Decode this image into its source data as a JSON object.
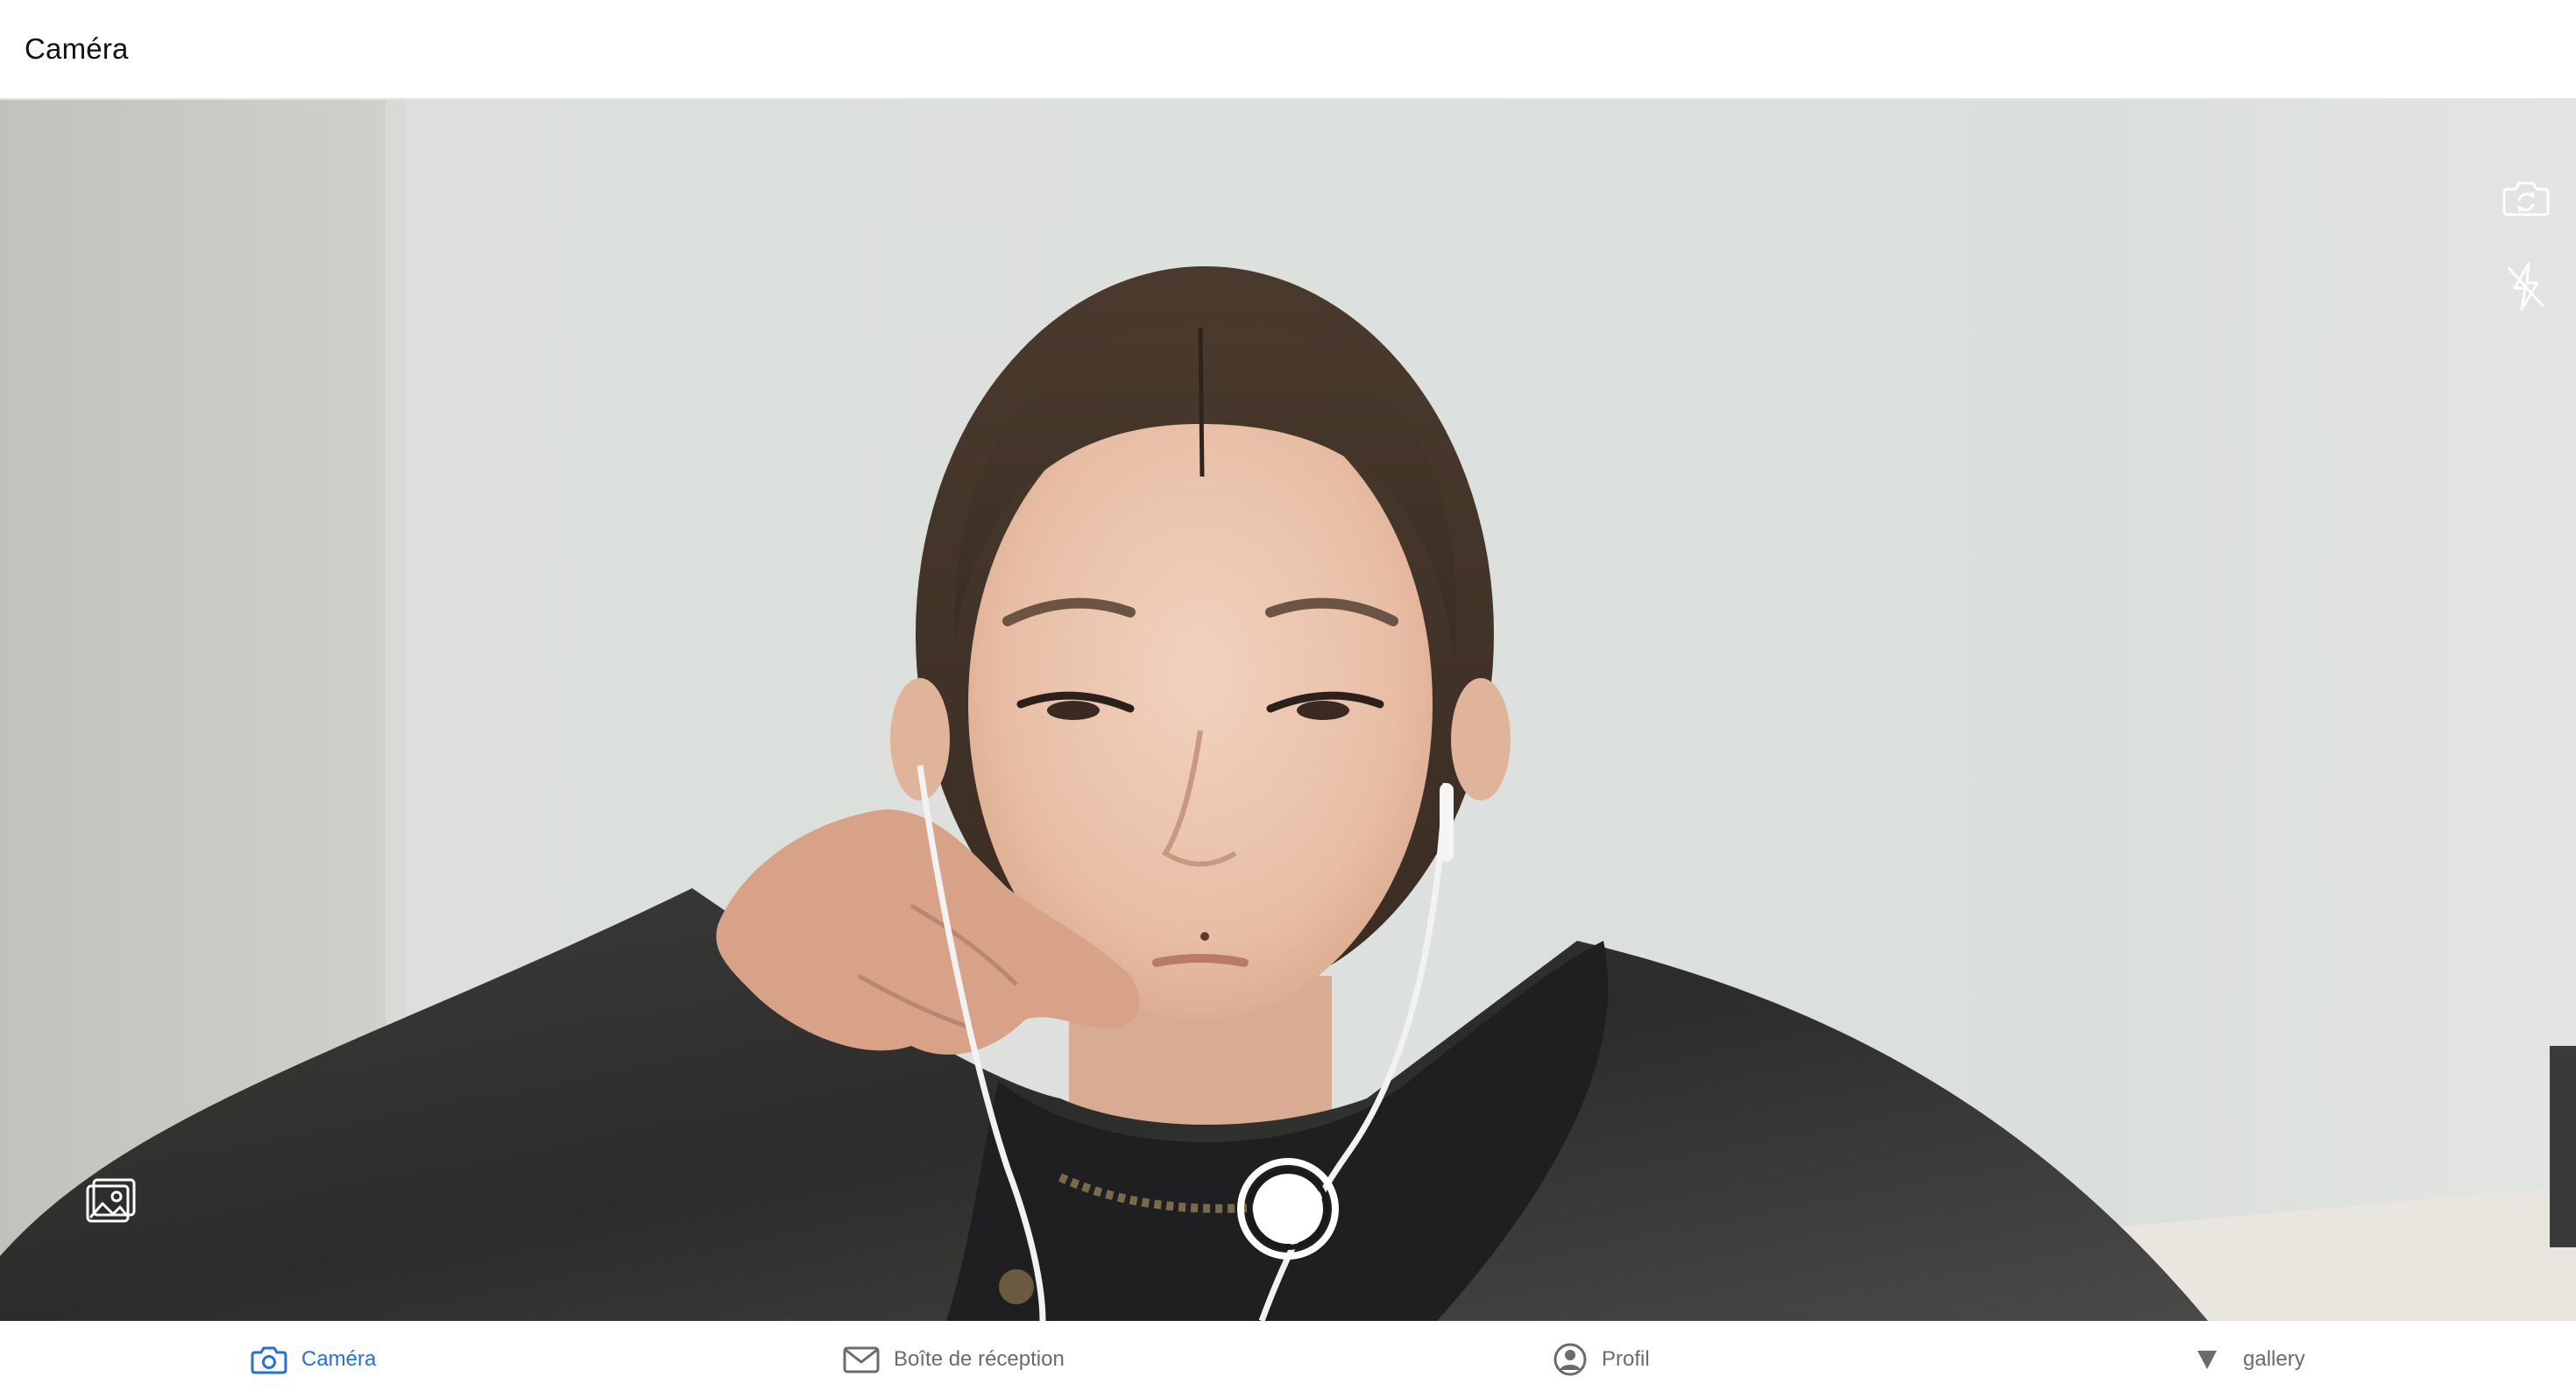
{
  "header": {
    "title": "Caméra"
  },
  "camera": {
    "switch_icon": "camera-switch-icon",
    "flash_icon": "flash-off-icon",
    "gallery_icon": "photo-gallery-icon",
    "shutter_icon": "shutter-button"
  },
  "tabs": [
    {
      "label": "Caméra",
      "icon": "camera-icon",
      "active": true
    },
    {
      "label": "Boîte de réception",
      "icon": "mail-icon",
      "active": false
    },
    {
      "label": "Profil",
      "icon": "user-circle-icon",
      "active": false
    },
    {
      "label": "gallery",
      "icon": "triangle-down-icon",
      "active": false
    }
  ],
  "colors": {
    "accent": "#2a6fd6",
    "inactive": "#6b6b6b",
    "header_text": "#111111"
  }
}
